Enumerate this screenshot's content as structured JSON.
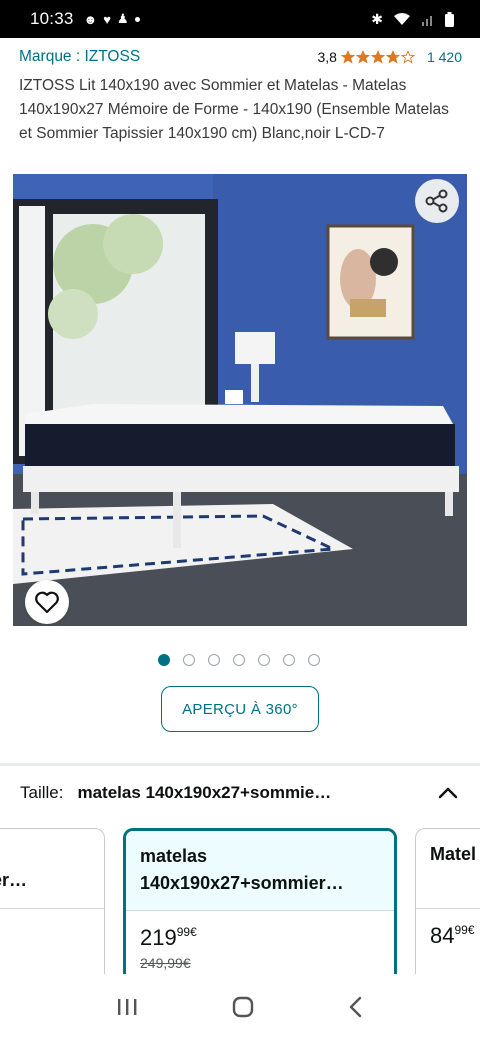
{
  "status_bar": {
    "time": "10:33"
  },
  "product": {
    "brand": "Marque : IZTOSS",
    "rating_value": "3,8",
    "rating_stars": 3.8,
    "rating_count": "1 420",
    "title": "IZTOSS Lit 140x190 avec Sommier et Matelas - Matelas 140x190x27 Mémoire de Forme - 140x190 (Ensemble Matelas et Sommier Tapissier 140x190 cm) Blanc,noir L-CD-7"
  },
  "gallery": {
    "image_count": 7,
    "active_index": 0,
    "view_360_label": "APERÇU À 360°"
  },
  "size_selector": {
    "label": "Taille:",
    "value": "matelas 140x190x27+sommie…",
    "options": [
      {
        "name": "mmier…",
        "price_whole": "",
        "price_fraction": "",
        "currency": "",
        "old_price": ""
      },
      {
        "name": "matelas 140x190x27+sommier…",
        "price_whole": "219",
        "price_fraction": "99",
        "currency": "€",
        "old_price": "249,99€"
      },
      {
        "name": "Matel",
        "price_whole": "84",
        "price_fraction": "99",
        "currency": "€",
        "old_price": ""
      }
    ]
  },
  "colors": {
    "accent": "#007185",
    "star": "#de7921",
    "wall": "#3f63b6"
  }
}
